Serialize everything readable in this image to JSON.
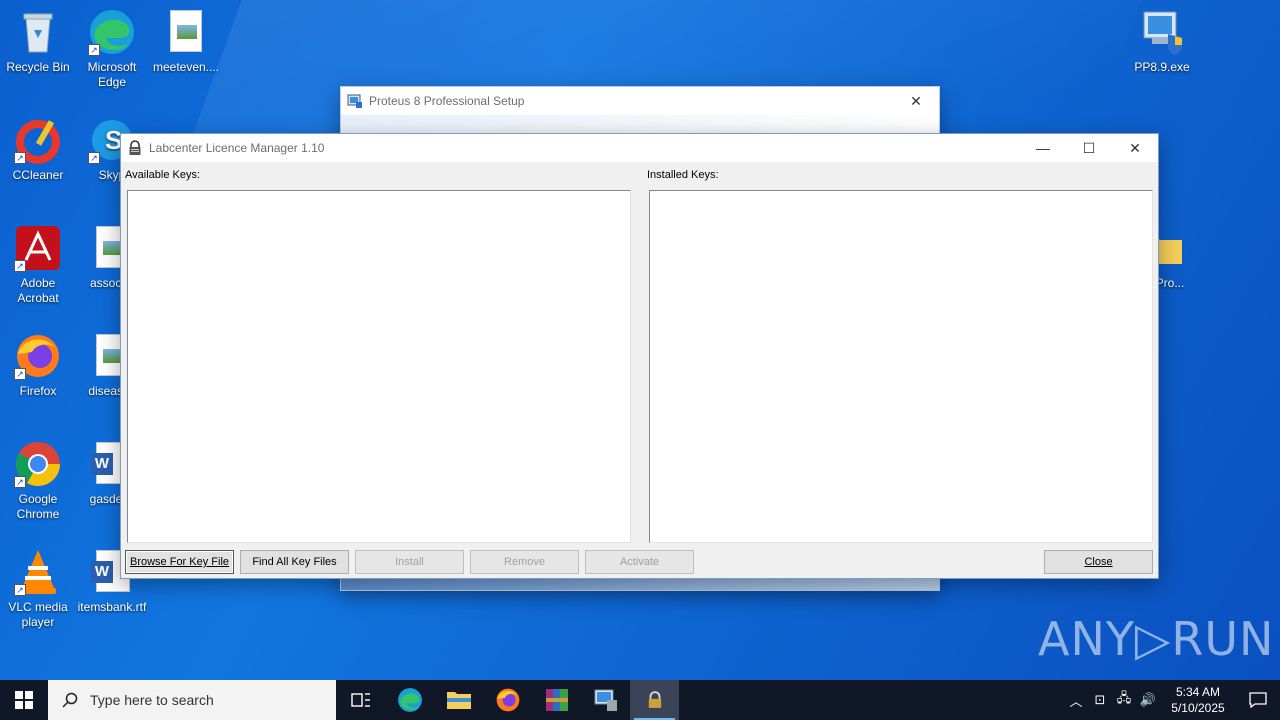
{
  "desktop": {
    "icons": [
      {
        "label": "Recycle Bin"
      },
      {
        "label": "Microsoft Edge"
      },
      {
        "label": "meeteven...."
      },
      {
        "label": "CCleaner"
      },
      {
        "label": "Skyp"
      },
      {
        "label": "Adobe Acrobat"
      },
      {
        "label": "associat"
      },
      {
        "label": "Firefox"
      },
      {
        "label": "diseases"
      },
      {
        "label": "Google Chrome"
      },
      {
        "label": "gasdesc"
      },
      {
        "label": "VLC media player"
      },
      {
        "label": "itemsbank.rtf"
      },
      {
        "label": "PP8.9.exe"
      },
      {
        "label": "us.Pro..."
      }
    ]
  },
  "setup_window": {
    "title": "Proteus 8 Professional Setup"
  },
  "licence_manager": {
    "title": "Labcenter Licence Manager 1.10",
    "available_label": "Available Keys:",
    "installed_label": "Installed Keys:",
    "buttons": {
      "browse": "Browse For Key File",
      "find_all": "Find All Key Files",
      "install": "Install",
      "remove": "Remove",
      "activate": "Activate",
      "close": "Close"
    }
  },
  "watermark": "ANY▷RUN",
  "taskbar": {
    "search_placeholder": "Type here to search",
    "time": "5:34 AM",
    "date": "5/10/2025"
  },
  "colors": {
    "desktop_blue": "#0f66d2",
    "taskbar": "#101827",
    "accent": "#76b9ed"
  }
}
